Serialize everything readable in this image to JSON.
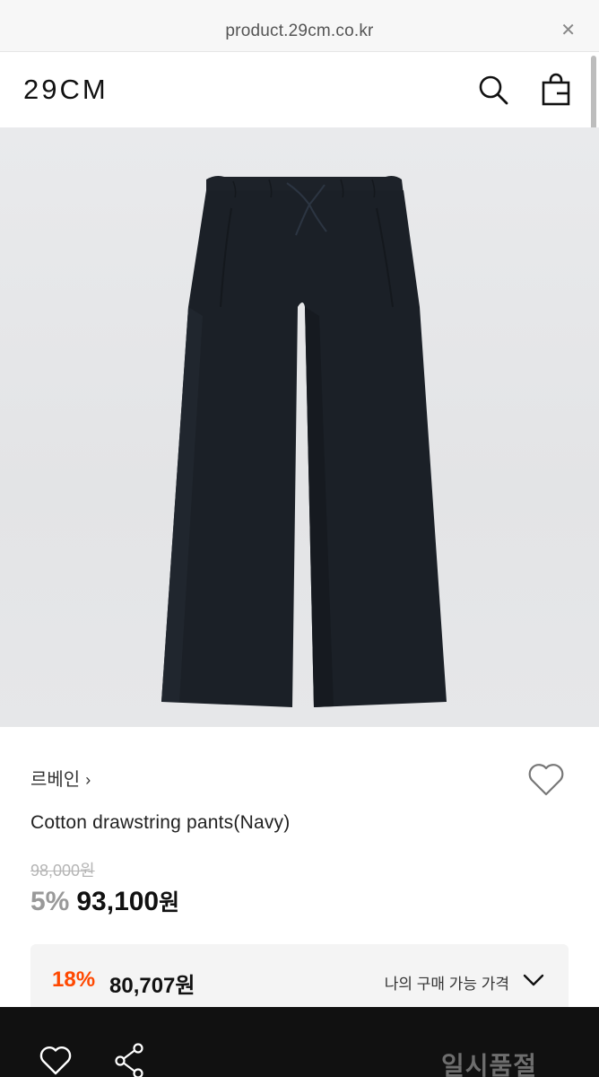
{
  "browser": {
    "url": "product.29cm.co.kr",
    "close_icon": "close-icon"
  },
  "header": {
    "logo": "29CM",
    "search_icon": "search-icon",
    "bag_icon": "shopping-bag-icon"
  },
  "product": {
    "image_icon": "product-photo",
    "brand": "르베인",
    "brand_chevron": "›",
    "name": "Cotton drawstring pants(Navy)",
    "original_price": "98,000원",
    "discount_rate": "5%",
    "sale_price": "93,100",
    "sale_price_unit": "원",
    "wish_icon": "heart-outline-icon"
  },
  "my_price": {
    "rate": "18%",
    "price": "80,707원",
    "label": "나의 구매 가능 가격",
    "chevron_icon": "chevron-down-icon",
    "rate_color": "#ff4800"
  },
  "bottom_bar": {
    "heart_icon": "heart-outline-icon",
    "share_icon": "share-icon",
    "status": "일시품절"
  }
}
